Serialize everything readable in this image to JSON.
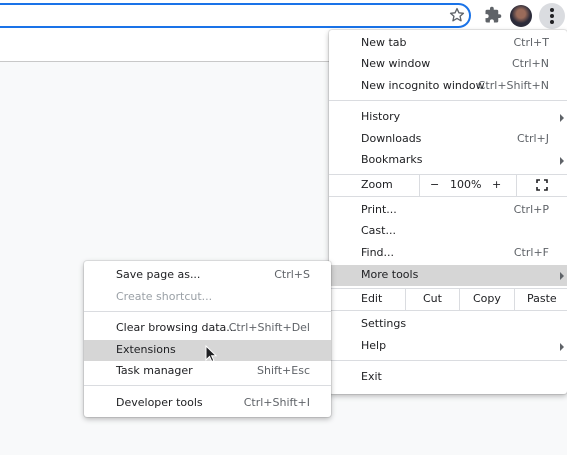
{
  "main_menu": {
    "new_tab": {
      "label": "New tab",
      "shortcut": "Ctrl+T"
    },
    "new_window": {
      "label": "New window",
      "shortcut": "Ctrl+N"
    },
    "new_incognito": {
      "label": "New incognito window",
      "shortcut": "Ctrl+Shift+N"
    },
    "history": {
      "label": "History"
    },
    "downloads": {
      "label": "Downloads",
      "shortcut": "Ctrl+J"
    },
    "bookmarks": {
      "label": "Bookmarks"
    },
    "zoom": {
      "label": "Zoom",
      "minus": "−",
      "value": "100%",
      "plus": "+"
    },
    "print": {
      "label": "Print...",
      "shortcut": "Ctrl+P"
    },
    "cast": {
      "label": "Cast..."
    },
    "find": {
      "label": "Find...",
      "shortcut": "Ctrl+F"
    },
    "more_tools": {
      "label": "More tools"
    },
    "edit": {
      "label": "Edit",
      "cut": "Cut",
      "copy": "Copy",
      "paste": "Paste"
    },
    "settings": {
      "label": "Settings"
    },
    "help": {
      "label": "Help"
    },
    "exit": {
      "label": "Exit"
    }
  },
  "sub_menu": {
    "save_page": {
      "label": "Save page as...",
      "shortcut": "Ctrl+S"
    },
    "create_shortcut": {
      "label": "Create shortcut..."
    },
    "clear_data": {
      "label": "Clear browsing data...",
      "shortcut": "Ctrl+Shift+Del"
    },
    "extensions": {
      "label": "Extensions"
    },
    "task_manager": {
      "label": "Task manager",
      "shortcut": "Shift+Esc"
    },
    "developer_tools": {
      "label": "Developer tools",
      "shortcut": "Ctrl+Shift+I"
    }
  },
  "toolbar": {
    "icons": [
      "star-icon",
      "extensions-puzzle-icon",
      "profile-avatar",
      "more-vertical-icon"
    ]
  },
  "colors": {
    "accent": "#1a73e8",
    "highlight": "#d6d6d6",
    "menu_bg": "#ffffff"
  }
}
